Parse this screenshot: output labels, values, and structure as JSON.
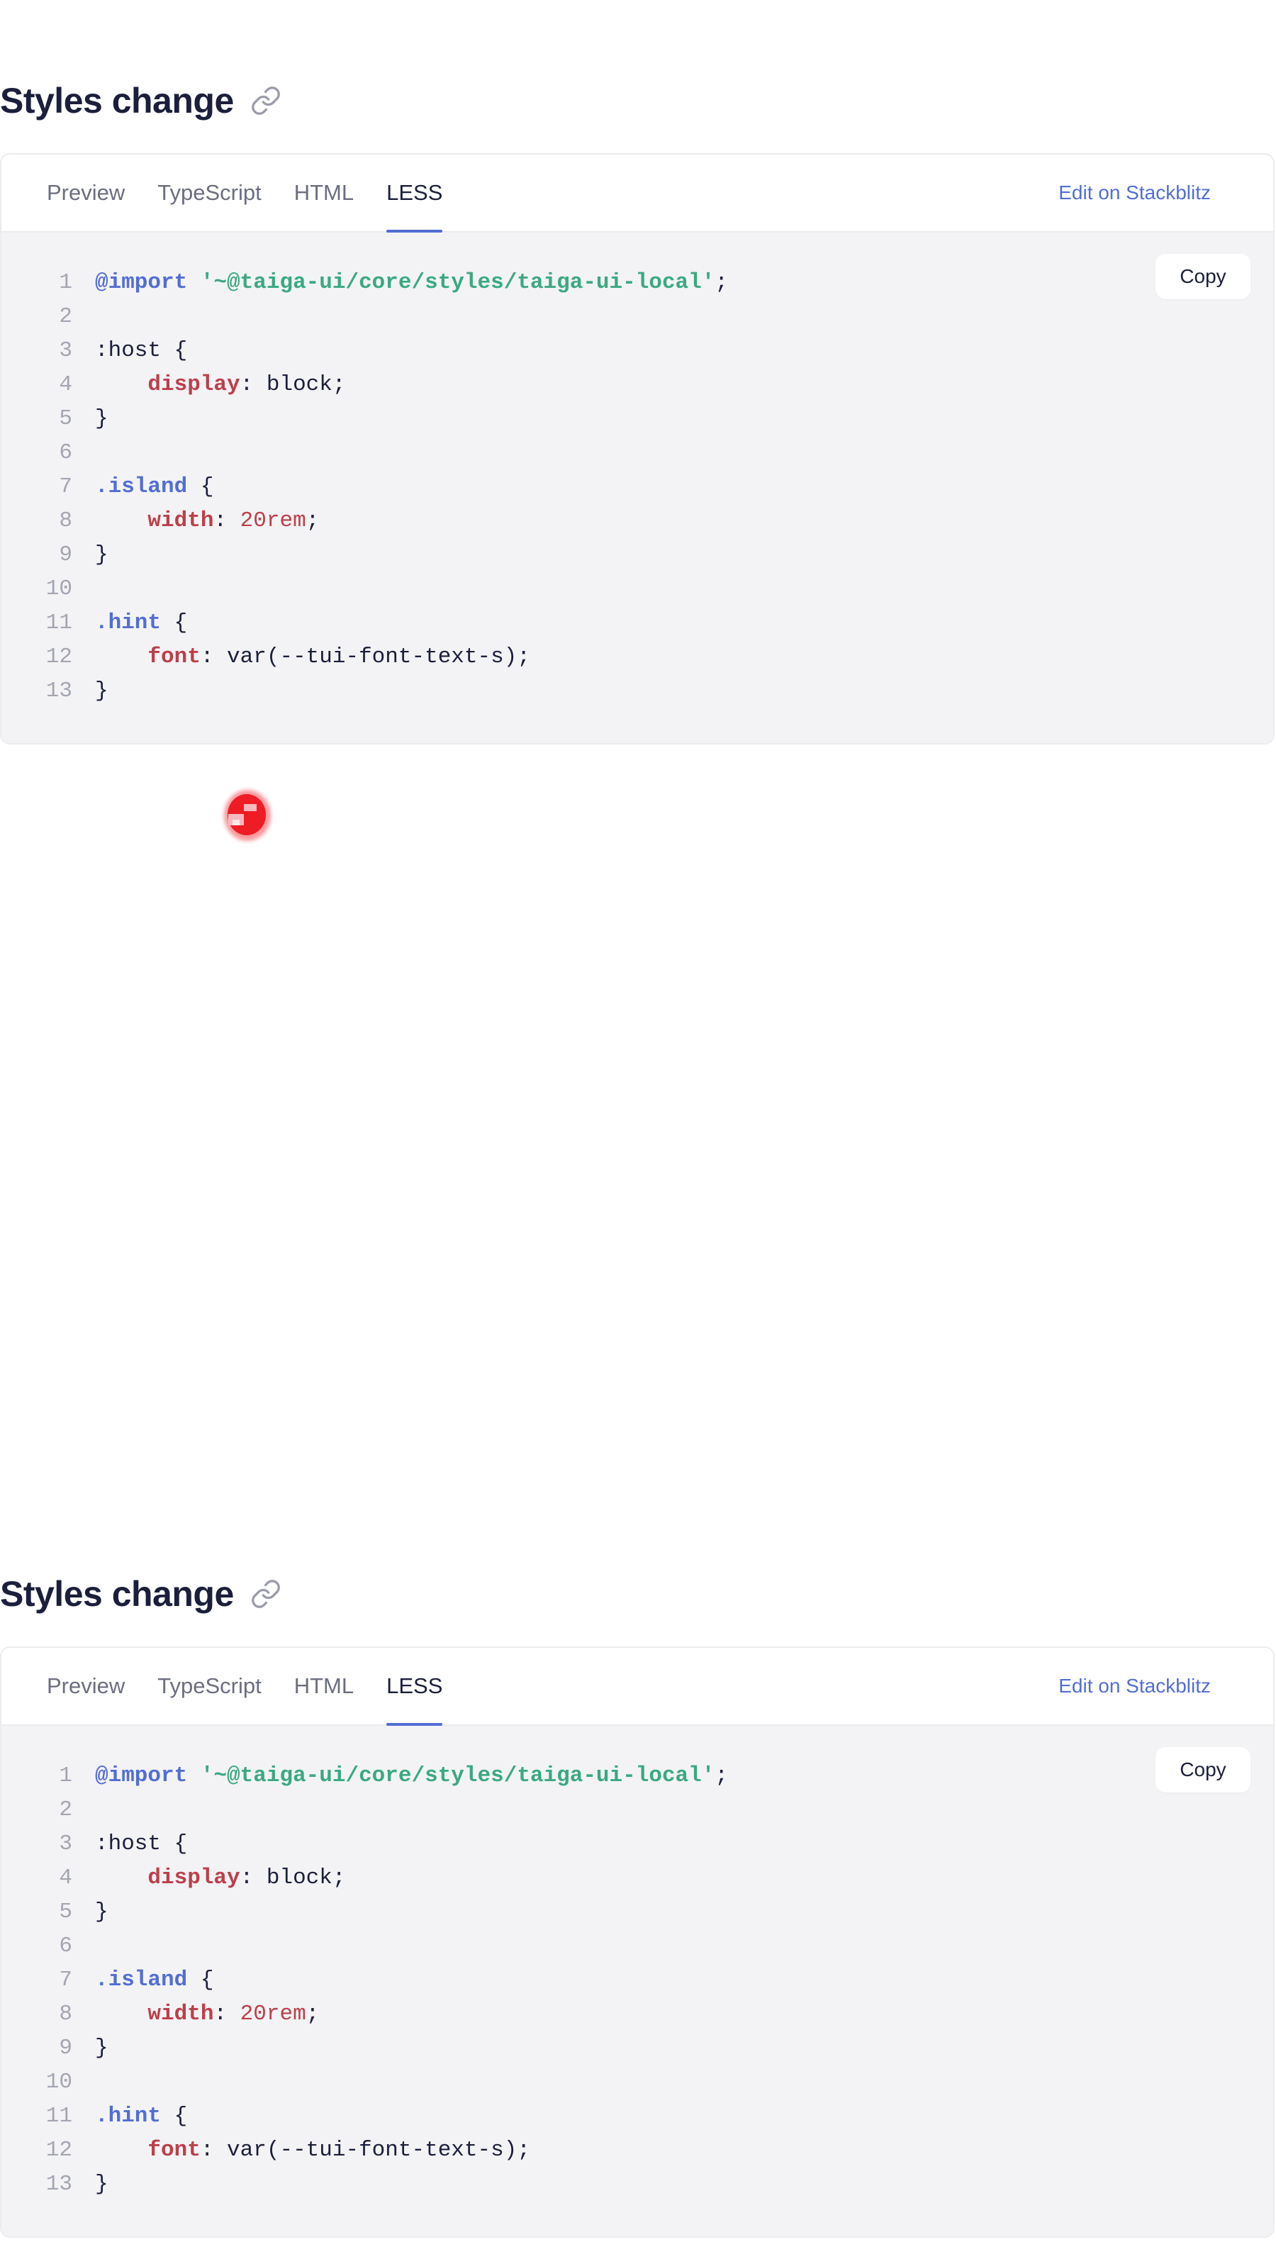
{
  "sections": [
    {
      "title": "Styles change",
      "tabs": [
        "Preview",
        "TypeScript",
        "HTML",
        "LESS"
      ],
      "active_tab": "LESS",
      "stackblitz_label": "Edit on Stackblitz",
      "copy_label": "Copy"
    },
    {
      "title": "Styles change",
      "tabs": [
        "Preview",
        "TypeScript",
        "HTML",
        "LESS"
      ],
      "active_tab": "LESS",
      "stackblitz_label": "Edit on Stackblitz",
      "copy_label": "Copy"
    }
  ],
  "code_lines": [
    [
      [
        "keyword",
        "@import"
      ],
      [
        "plain",
        " "
      ],
      [
        "string",
        "'~@taiga-ui/core/styles/taiga-ui-local'"
      ],
      [
        "plain",
        ";"
      ]
    ],
    [],
    [
      [
        "plain",
        ":host {"
      ]
    ],
    [
      [
        "plain",
        "    "
      ],
      [
        "prop",
        "display"
      ],
      [
        "plain",
        ": block;"
      ]
    ],
    [
      [
        "plain",
        "}"
      ]
    ],
    [],
    [
      [
        "selector",
        ".island"
      ],
      [
        "plain",
        " {"
      ]
    ],
    [
      [
        "plain",
        "    "
      ],
      [
        "prop",
        "width"
      ],
      [
        "plain",
        ": "
      ],
      [
        "num",
        "20rem"
      ],
      [
        "plain",
        ";"
      ]
    ],
    [
      [
        "plain",
        "}"
      ]
    ],
    [],
    [
      [
        "selector",
        ".hint"
      ],
      [
        "plain",
        " {"
      ]
    ],
    [
      [
        "plain",
        "    "
      ],
      [
        "prop",
        "font"
      ],
      [
        "plain",
        ": var(--tui-font-text-s);"
      ]
    ],
    [
      [
        "plain",
        "}"
      ]
    ]
  ],
  "colors": {
    "accent": "#526ed3",
    "string": "#3aa981",
    "property": "#bc3f4a",
    "code_background": "#f3f3f5",
    "cursor_red": "#ee1c25"
  },
  "icons": {
    "heading_link": "link-icon",
    "cursor": "red-cursor-indicator"
  }
}
